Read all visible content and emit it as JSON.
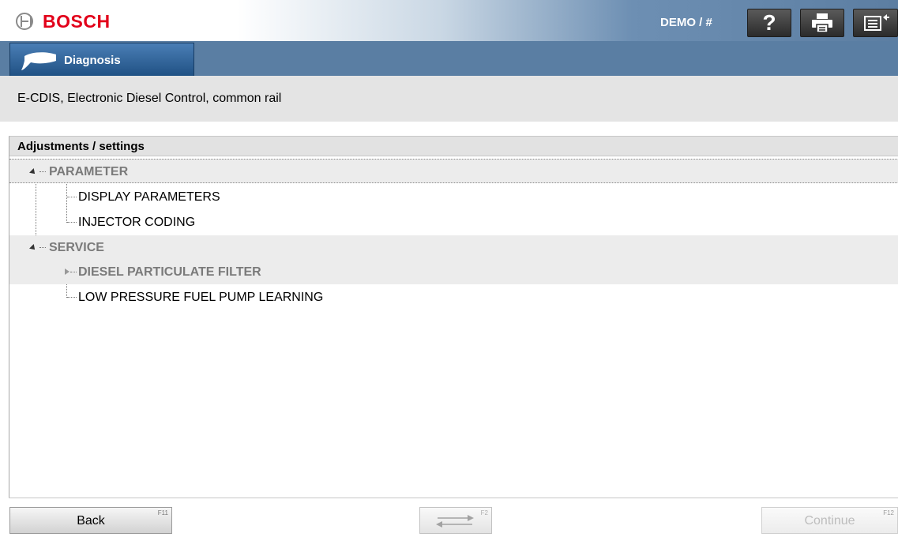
{
  "header": {
    "brand": "BOSCH",
    "user_label": "DEMO / #",
    "icons": [
      "help-icon",
      "print-icon",
      "documents-icon"
    ]
  },
  "nav": {
    "tab_label": "Diagnosis",
    "tab_icon": "diagnostic-plug-icon"
  },
  "subtitle": "E-CDIS, Electronic Diesel Control, common rail",
  "panel": {
    "title": "Adjustments / settings",
    "tree": [
      {
        "label": "PARAMETER",
        "level": 0,
        "expanded": true,
        "selected": true,
        "children": [
          "DISPLAY PARAMETERS",
          "INJECTOR CODING"
        ]
      },
      {
        "label": "SERVICE",
        "level": 0,
        "expanded": true,
        "children": [
          "DIESEL PARTICULATE FILTER",
          "LOW PRESSURE FUEL PUMP LEARNING"
        ]
      }
    ]
  },
  "footer": {
    "back_label": "Back",
    "back_key": "F11",
    "swap_key": "F2",
    "continue_label": "Continue",
    "continue_key": "F12",
    "continue_enabled": false
  },
  "colors": {
    "brand_red": "#e2001a",
    "header_blue": "#5a7ea3",
    "tab_blue": "#1e4f82"
  }
}
